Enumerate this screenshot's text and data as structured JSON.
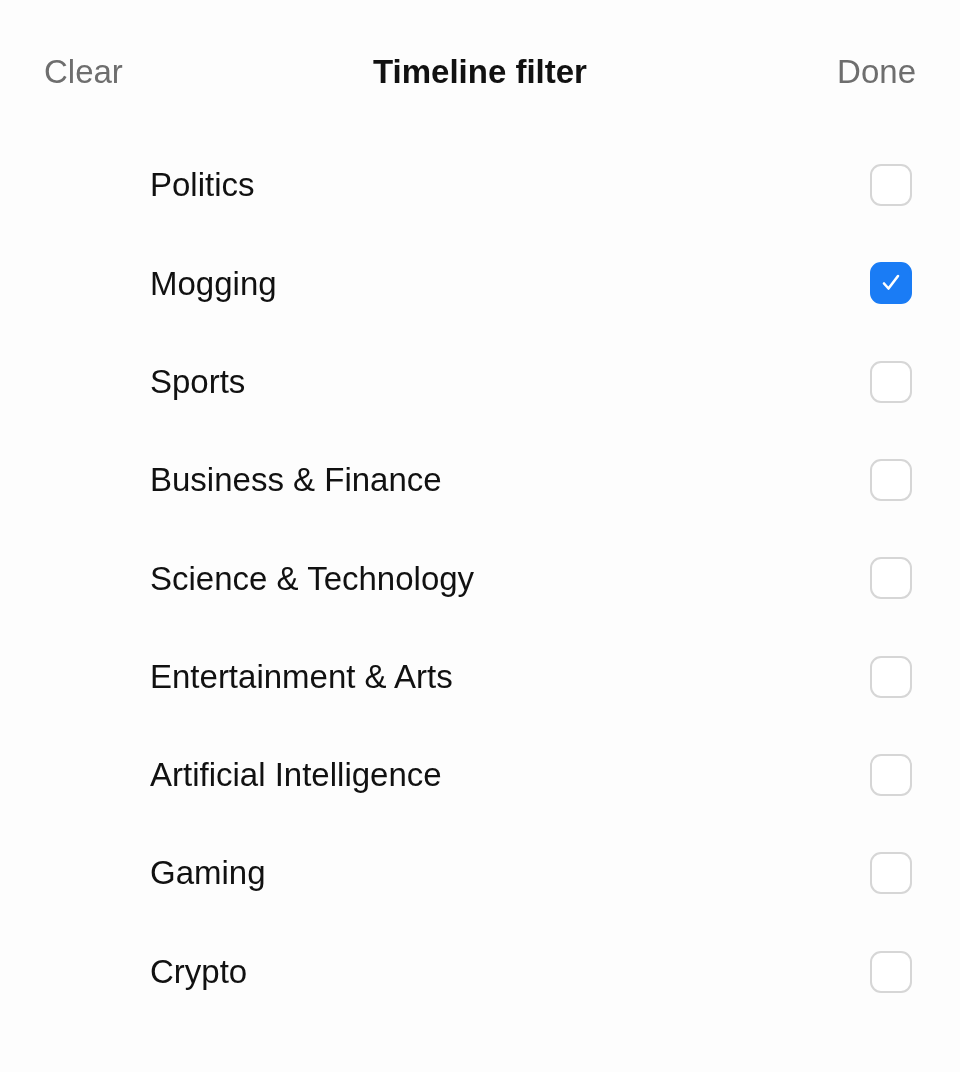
{
  "header": {
    "left_button": "Clear",
    "title": "Timeline filter",
    "right_button": "Done"
  },
  "topics": [
    {
      "label": "Politics",
      "checked": false
    },
    {
      "label": "Mogging",
      "checked": true
    },
    {
      "label": "Sports",
      "checked": false
    },
    {
      "label": "Business & Finance",
      "checked": false
    },
    {
      "label": "Science & Technology",
      "checked": false
    },
    {
      "label": "Entertainment & Arts",
      "checked": false
    },
    {
      "label": "Artificial Intelligence",
      "checked": false
    },
    {
      "label": "Gaming",
      "checked": false
    },
    {
      "label": "Crypto",
      "checked": false
    }
  ]
}
